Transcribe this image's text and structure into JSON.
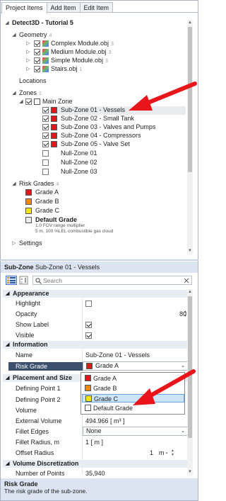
{
  "tabs": [
    "Project Items",
    "Add Item",
    "Edit Item"
  ],
  "tree": {
    "root": "Detect3D - Tutorial 5",
    "geometry_label": "Geometry",
    "geometry_count": "4",
    "geometry_items": [
      {
        "name": "Complex Module.obj",
        "count": "3"
      },
      {
        "name": "Medium Module.obj",
        "count": "3"
      },
      {
        "name": "Simple Module.obj",
        "count": "3"
      },
      {
        "name": "Stairs.obj",
        "count": "1"
      }
    ],
    "locations_label": "Locations",
    "zones_label": "Zones",
    "zones_count": "1",
    "main_zone": "Main Zone",
    "sub_zones": [
      {
        "name": "Sub-Zone 01 - Vessels",
        "checked": true,
        "color": "#e0161a"
      },
      {
        "name": "Sub-Zone 02 - Small Tank",
        "checked": true,
        "color": "#e0161a"
      },
      {
        "name": "Sub-Zone 03 - Valves and Pumps",
        "checked": true,
        "color": "#e0161a"
      },
      {
        "name": "Sub-Zone 04 - Compressors",
        "checked": true,
        "color": "#e0161a"
      },
      {
        "name": "Sub-Zone 05 - Valve Set",
        "checked": true,
        "color": "#e0161a"
      },
      {
        "name": "Null-Zone 01",
        "checked": false,
        "color": ""
      },
      {
        "name": "Null-Zone 02",
        "checked": false,
        "color": ""
      },
      {
        "name": "Null-Zone 03",
        "checked": false,
        "color": ""
      }
    ],
    "risk_grades_label": "Risk Grades",
    "risk_grades_count": "4",
    "risk_grades": [
      {
        "name": "Grade A",
        "color": "#e0161a"
      },
      {
        "name": "Grade B",
        "color": "#f08a00"
      },
      {
        "name": "Grade C",
        "color": "#f4e600"
      }
    ],
    "default_grade": "Default Grade",
    "default_grade_line1": "1.0 FOV range multiplier",
    "default_grade_line2": "5 m, 100 %LEL combustible gas cloud",
    "settings_label": "Settings"
  },
  "props": {
    "header_type": "Sub-Zone",
    "header_name": "Sub-Zone 01 - Vessels",
    "search_placeholder": "Search",
    "cat_appearance": "Appearance",
    "highlight": "Highlight",
    "opacity": "Opacity",
    "opacity_value": "80",
    "show_label": "Show Label",
    "visible": "Visible",
    "cat_information": "Information",
    "name_label": "Name",
    "name_value": "Sub-Zone 01 - Vessels",
    "risk_grade_label": "Risk Grade",
    "risk_grade_value": "Grade A",
    "cat_placement": "Placement and Size",
    "defining_point_1": "Defining Point 1",
    "defining_point_2": "Defining Point 2",
    "volume": "Volume",
    "external_volume": "External Volume",
    "external_volume_value": "494.966 [ m³ ]",
    "fillet_edges": "Fillet Edges",
    "fillet_edges_value": "None",
    "fillet_radius": "Fillet Radius, m",
    "fillet_radius_value": "1 [ m ]",
    "offset_radius": "Offset Radius",
    "offset_radius_value": "1",
    "offset_radius_unit": "m",
    "cat_volume_disc": "Volume Discretization",
    "number_of_points": "Number of Points",
    "number_of_points_value": "35,940",
    "dropdown_items": [
      {
        "name": "Grade A",
        "color": "#e0161a"
      },
      {
        "name": "Grade B",
        "color": "#f08a00"
      },
      {
        "name": "Grade C",
        "color": "#f4e600"
      },
      {
        "name": "Default Grade",
        "color": "#ffffff"
      }
    ]
  },
  "description": {
    "title": "Risk Grade",
    "text": "The risk grade of the sub-zone."
  },
  "colors": {
    "accent_arrow": "#e8161b",
    "selection": "#3c4f6c",
    "header_bg": "#dbe4f0"
  }
}
